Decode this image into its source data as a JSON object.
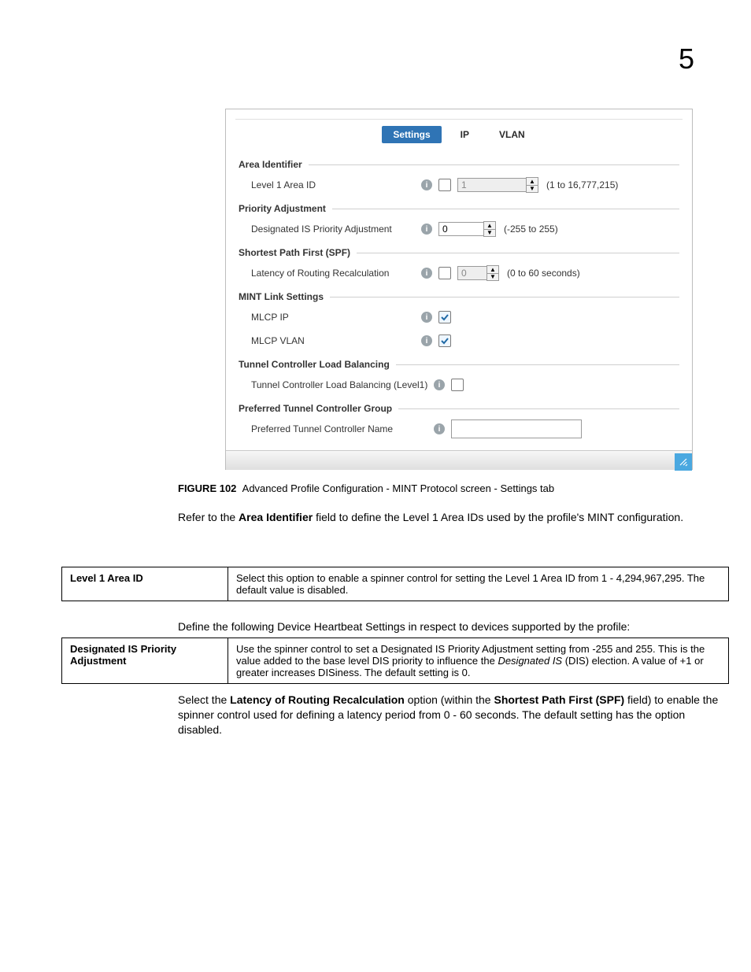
{
  "pageNumber": "5",
  "tabs": {
    "settings": "Settings",
    "ip": "IP",
    "vlan": "VLAN"
  },
  "section": {
    "areaIdentifier": "Area Identifier",
    "priorityAdjustment": "Priority Adjustment",
    "spf": "Shortest Path First (SPF)",
    "mintLink": "MINT Link Settings",
    "tunnelLB": "Tunnel Controller Load Balancing",
    "prefTunnel": "Preferred Tunnel Controller Group"
  },
  "field": {
    "level1AreaId": "Level 1 Area ID",
    "level1AreaIdValue": "1",
    "level1AreaIdRange": "(1 to 16,777,215)",
    "disPriority": "Designated IS Priority Adjustment",
    "disPriorityValue": "0",
    "disPriorityRange": "(-255 to 255)",
    "latencyRecalc": "Latency of Routing Recalculation",
    "latencyRecalcValue": "0",
    "latencyRecalcRange": "(0 to 60 seconds)",
    "mlcpIp": "MLCP IP",
    "mlcpVlan": "MLCP VLAN",
    "tclbLevel1": "Tunnel Controller Load Balancing (Level1)",
    "prefTunnelName": "Preferred Tunnel Controller Name"
  },
  "caption": {
    "num": "FIGURE 102",
    "text": "Advanced Profile Configuration - MINT Protocol screen - Settings tab"
  },
  "body": {
    "p1a": "Refer to the ",
    "p1b": "Area Identifier",
    "p1c": " field to define the Level 1 Area IDs used by the profile's MINT configuration.",
    "p2": "Define the following Device Heartbeat Settings in respect to devices supported by the profile:",
    "p3a": "Select the ",
    "p3b": "Latency of Routing Recalculation",
    "p3c": " option (within the ",
    "p3d": "Shortest Path First (SPF)",
    "p3e": " field) to enable the spinner control used for defining a latency period from 0 - 60 seconds. The default setting has the option disabled."
  },
  "table1": {
    "k": "Level 1 Area ID",
    "v": "Select this option to enable a spinner control for setting the Level 1 Area ID from 1 - 4,294,967,295. The default value is disabled."
  },
  "table2": {
    "k": "Designated IS Priority Adjustment",
    "v1": "Use the spinner control to set a Designated IS Priority Adjustment setting from -255 and 255. This is the value added to the base level DIS priority to influence the ",
    "v2": "Designated IS",
    "v3": " (DIS) election. A value of +1 or greater increases DISiness. The default setting is 0."
  }
}
